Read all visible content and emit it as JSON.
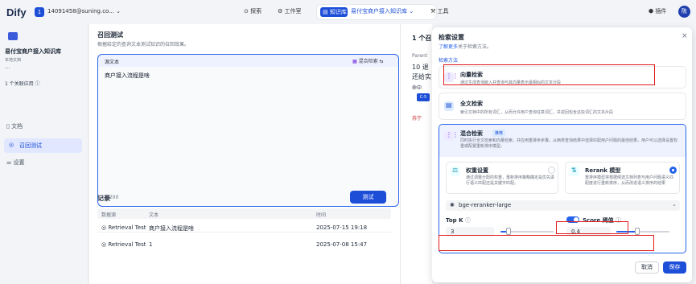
{
  "topbar": {
    "logo": "Dify",
    "workspace_badge": "1",
    "workspace_name": "14091458@suning.co...",
    "nav_explore": "探索",
    "nav_studio": "工作室",
    "nav_knowledge": "知识库",
    "nav_dataset": "易付宝商户接入知识库",
    "nav_tools": "工具",
    "plugins": "插件",
    "avatar": "陈"
  },
  "sidebar": {
    "title": "易付宝商户接入知识库",
    "subtitle": "本地文档",
    "dots": "···",
    "linked_apps": "1 个关联应用",
    "items": [
      {
        "label": "文档"
      },
      {
        "label": "召回测试"
      },
      {
        "label": "设置"
      }
    ]
  },
  "main": {
    "title": "召回测试",
    "desc": "根据给定的查询文本测试知识的召回效果。",
    "source_label": "源文本",
    "mode_chip": "混合检索",
    "query": "商户接入流程是啥",
    "counter": "8/200",
    "test_button": "测试",
    "records_title": "记录",
    "col_source": "数据源",
    "col_text": "文本",
    "col_time": "时间",
    "records": [
      {
        "source": "Retrieval Test",
        "text": "商户接入流程是啥",
        "time": "2025-07-15 19:18"
      },
      {
        "source": "Retrieval Test",
        "text": "1",
        "time": "2025-07-08 15:47"
      }
    ]
  },
  "right": {
    "title": "1 个召",
    "parent": "Parent",
    "line1": "10 退",
    "line2": "还给实",
    "toggle": "命中",
    "c5": "C-5",
    "suning": "苏宁"
  },
  "panel": {
    "title": "检索设置",
    "learn_more": "了解更多",
    "learn_more_tail": "关于检索方法。",
    "method_label": "检索方法",
    "vector_title": "向量检索",
    "vector_desc": "通过生成查询嵌入并查询与其向量表示最相似的文本分段",
    "fulltext_title": "全文检索",
    "fulltext_desc": "索引文档中的所有词汇，从而允许用户查询任意词汇，并返回包含这些词汇的文本片段",
    "hybrid_title": "混合检索",
    "hybrid_badge": "推荐",
    "hybrid_desc": "同时执行全文检索和向量检索，并应用重排序步骤，从两类查询结果中选择匹配用户问题的最佳结果，用户可以选择设置权重或配置重新排序模型。",
    "weight_title": "权重设置",
    "weight_desc": "通过调整分配的权重，重新排序策略确定是优先进行语义匹配还是关键字匹配。",
    "rerank_title": "Rerank 模型",
    "rerank_desc": "重排序模型将根据候选文档列表与用户问题语义匹配度进行重新排序，从而改进语义排序的结果",
    "rerank_model": "bge-reranker-large",
    "topk_label": "Top K",
    "topk_value": "3",
    "topk_fraction": 0.15,
    "score_label": "Score 阈值",
    "score_value": "0.4",
    "score_fraction": 0.4,
    "cancel": "取消",
    "save": "保存",
    "accent": "#1d4ed8"
  }
}
